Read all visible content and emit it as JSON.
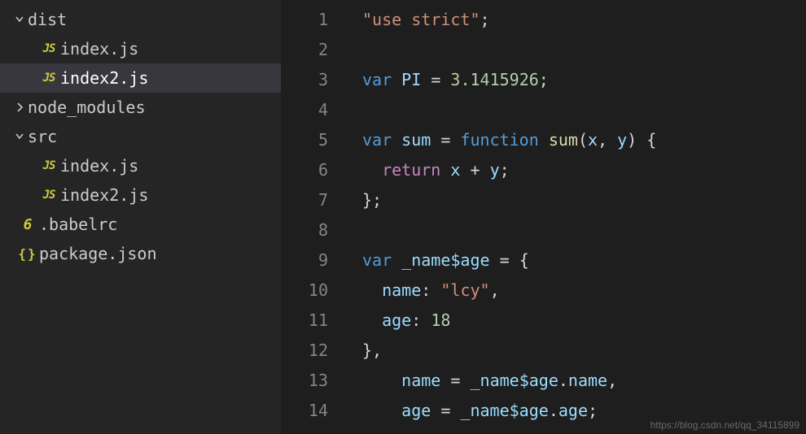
{
  "sidebar": {
    "items": [
      {
        "type": "folder",
        "label": "dist",
        "expanded": true,
        "indent": 0,
        "selected": false
      },
      {
        "type": "file",
        "label": "index.js",
        "icon": "JS",
        "indent": 32,
        "selected": false
      },
      {
        "type": "file",
        "label": "index2.js",
        "icon": "JS",
        "indent": 32,
        "selected": true
      },
      {
        "type": "folder",
        "label": "node_modules",
        "expanded": false,
        "indent": 0,
        "selected": false
      },
      {
        "type": "folder",
        "label": "src",
        "expanded": true,
        "indent": 0,
        "selected": false
      },
      {
        "type": "file",
        "label": "index.js",
        "icon": "JS",
        "indent": 32,
        "selected": false
      },
      {
        "type": "file",
        "label": "index2.js",
        "icon": "JS",
        "indent": 32,
        "selected": false
      },
      {
        "type": "file",
        "label": ".babelrc",
        "icon": "6",
        "indent": 6,
        "selected": false,
        "iconClass": "icon-babel"
      },
      {
        "type": "file",
        "label": "package.json",
        "icon": "{}",
        "indent": 6,
        "selected": false,
        "iconClass": "icon-json"
      }
    ]
  },
  "editor": {
    "line_numbers": [
      "1",
      "2",
      "3",
      "4",
      "5",
      "6",
      "7",
      "8",
      "9",
      "10",
      "11",
      "12",
      "13",
      "14"
    ],
    "lines": [
      [
        [
          "str",
          "\"use strict\""
        ],
        [
          "pun",
          ";"
        ]
      ],
      [],
      [
        [
          "kw",
          "var"
        ],
        [
          "op",
          " "
        ],
        [
          "var",
          "PI"
        ],
        [
          "op",
          " "
        ],
        [
          "pun",
          "="
        ],
        [
          "op",
          " "
        ],
        [
          "num",
          "3.1415926"
        ],
        [
          "pun",
          ";"
        ]
      ],
      [],
      [
        [
          "kw",
          "var"
        ],
        [
          "op",
          " "
        ],
        [
          "var",
          "sum"
        ],
        [
          "op",
          " "
        ],
        [
          "pun",
          "="
        ],
        [
          "op",
          " "
        ],
        [
          "kw",
          "function"
        ],
        [
          "op",
          " "
        ],
        [
          "fn",
          "sum"
        ],
        [
          "pun",
          "("
        ],
        [
          "var",
          "x"
        ],
        [
          "pun",
          ","
        ],
        [
          "op",
          " "
        ],
        [
          "var",
          "y"
        ],
        [
          "pun",
          ")"
        ],
        [
          "op",
          " "
        ],
        [
          "pun",
          "{"
        ]
      ],
      [
        [
          "guide",
          "  "
        ],
        [
          "kw2",
          "return"
        ],
        [
          "op",
          " "
        ],
        [
          "var",
          "x"
        ],
        [
          "op",
          " "
        ],
        [
          "pun",
          "+"
        ],
        [
          "op",
          " "
        ],
        [
          "var",
          "y"
        ],
        [
          "pun",
          ";"
        ]
      ],
      [
        [
          "pun",
          "};"
        ]
      ],
      [],
      [
        [
          "kw",
          "var"
        ],
        [
          "op",
          " "
        ],
        [
          "var",
          "_name$age"
        ],
        [
          "op",
          " "
        ],
        [
          "pun",
          "="
        ],
        [
          "op",
          " "
        ],
        [
          "pun",
          "{"
        ]
      ],
      [
        [
          "guide",
          "  "
        ],
        [
          "prop",
          "name"
        ],
        [
          "pun",
          ":"
        ],
        [
          "op",
          " "
        ],
        [
          "str",
          "\"lcy\""
        ],
        [
          "pun",
          ","
        ]
      ],
      [
        [
          "guide",
          "  "
        ],
        [
          "prop",
          "age"
        ],
        [
          "pun",
          ":"
        ],
        [
          "op",
          " "
        ],
        [
          "num",
          "18"
        ]
      ],
      [
        [
          "pun",
          "},"
        ]
      ],
      [
        [
          "guide",
          "    "
        ],
        [
          "var",
          "name"
        ],
        [
          "op",
          " "
        ],
        [
          "pun",
          "="
        ],
        [
          "op",
          " "
        ],
        [
          "var",
          "_name$age"
        ],
        [
          "pun",
          "."
        ],
        [
          "var",
          "name"
        ],
        [
          "pun",
          ","
        ]
      ],
      [
        [
          "guide",
          "    "
        ],
        [
          "var",
          "age"
        ],
        [
          "op",
          " "
        ],
        [
          "pun",
          "="
        ],
        [
          "op",
          " "
        ],
        [
          "var",
          "_name$age"
        ],
        [
          "pun",
          "."
        ],
        [
          "var",
          "age"
        ],
        [
          "pun",
          ";"
        ]
      ]
    ]
  },
  "watermark": "https://blog.csdn.net/qq_34115899"
}
